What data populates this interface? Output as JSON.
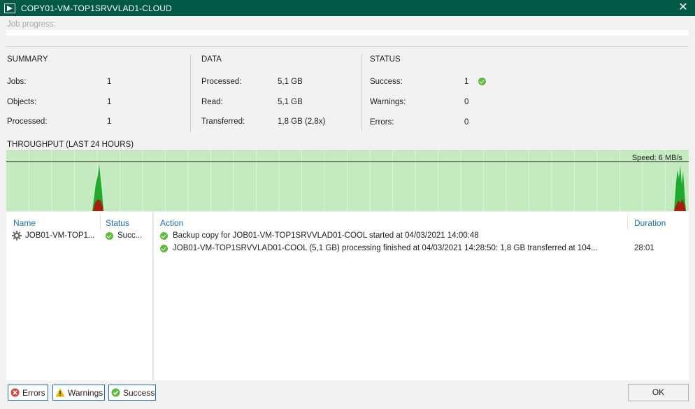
{
  "window": {
    "title": "COPY01-VM-TOP1SRVVLAD1-CLOUD",
    "close_glyph": "✕"
  },
  "progress": {
    "label": "Job progress:",
    "percent": 0
  },
  "summary": {
    "title": "SUMMARY",
    "rows": [
      {
        "key": "Jobs:",
        "value": "1"
      },
      {
        "key": "Objects:",
        "value": "1"
      },
      {
        "key": "Processed:",
        "value": "1"
      }
    ]
  },
  "data_section": {
    "title": "DATA",
    "rows": [
      {
        "key": "Processed:",
        "value": "5,1 GB"
      },
      {
        "key": "Read:",
        "value": "5,1 GB"
      },
      {
        "key": "Transferred:",
        "value": "1,8 GB (2,8x)"
      }
    ]
  },
  "status_section": {
    "title": "STATUS",
    "rows": [
      {
        "key": "Success:",
        "value": "1",
        "icon": "success-check-icon"
      },
      {
        "key": "Warnings:",
        "value": "0"
      },
      {
        "key": "Errors:",
        "value": "0"
      }
    ]
  },
  "throughput": {
    "title": "THROUGHPUT (LAST 24 HOURS)",
    "speed_label": "Speed: 6 MB/s",
    "colors": {
      "background": "#c4ebc0",
      "green": "#1faa2e",
      "red": "#a51f0f",
      "grid": "#e6f6e4"
    }
  },
  "jobs_table": {
    "headers": {
      "name": "Name",
      "status": "Status"
    },
    "rows": [
      {
        "name": "JOB01-VM-TOP1...",
        "status": "Succ...",
        "icon": "gear-icon"
      }
    ]
  },
  "log_table": {
    "headers": {
      "action": "Action",
      "duration": "Duration"
    },
    "rows": [
      {
        "action": "Backup copy for JOB01-VM-TOP1SRVVLAD01-COOL started at 04/03/2021 14:00:48",
        "duration": ""
      },
      {
        "action": "JOB01-VM-TOP1SRVVLAD01-COOL (5,1 GB) processing finished at 04/03/2021 14:28:50: 1,8 GB transferred at 104...",
        "duration": "28:01"
      }
    ]
  },
  "footer": {
    "errors_label": "Errors",
    "warnings_label": "Warnings",
    "success_label": "Success",
    "ok_label": "OK"
  },
  "colors": {
    "titlebar": "#005a46",
    "accent_blue": "#1c6fb3",
    "success_green": "#5cbb3a"
  }
}
